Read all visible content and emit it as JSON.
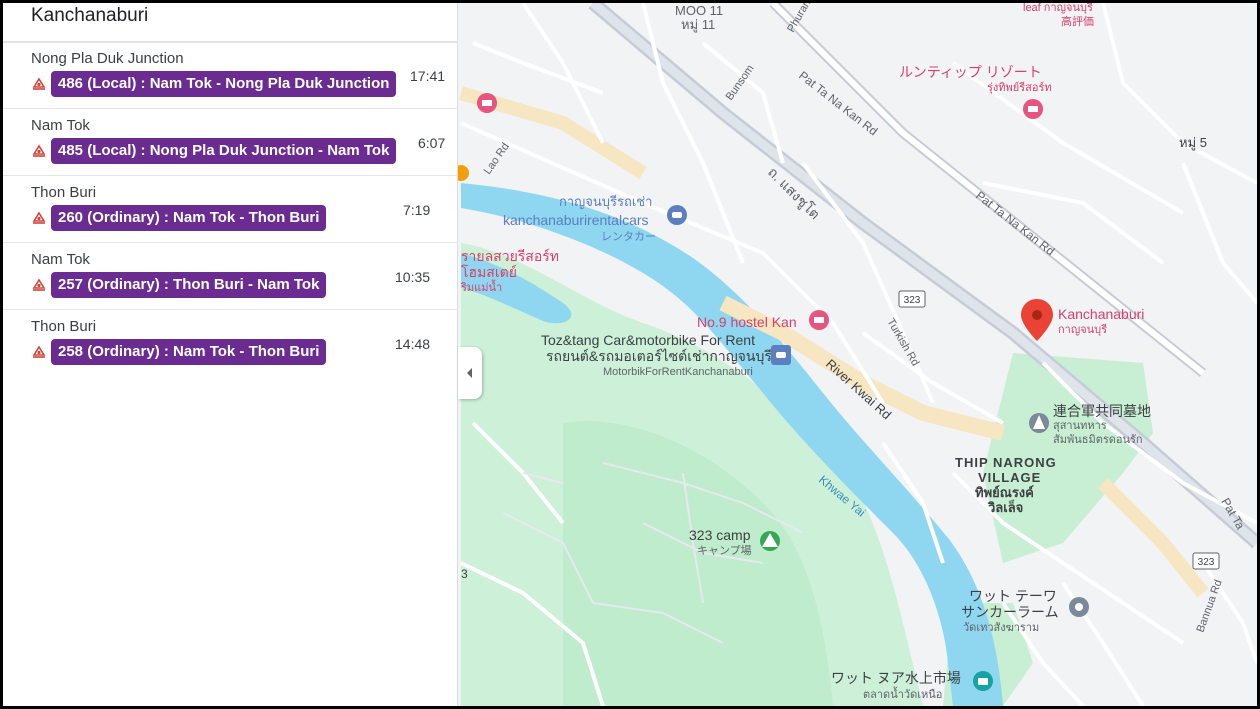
{
  "panel": {
    "title": "Kanchanaburi",
    "departures": [
      {
        "destination": "Nong Pla Duk Junction",
        "route": "486 (Local) : Nam Tok - Nong Pla Duk Junction",
        "time": "17:41"
      },
      {
        "destination": "Nam Tok",
        "route": "485 (Local) : Nong Pla Duk Junction - Nam Tok",
        "time": "6:07"
      },
      {
        "destination": "Thon Buri",
        "route": "260 (Ordinary) : Nam Tok - Thon Buri",
        "time": "7:19"
      },
      {
        "destination": "Nam Tok",
        "route": "257 (Ordinary) : Thon Buri - Nam Tok",
        "time": "10:35"
      },
      {
        "destination": "Thon Buri",
        "route": "258 (Ordinary) : Nam Tok - Thon Buri",
        "time": "14:48"
      }
    ]
  },
  "map": {
    "labels": {
      "moo11": "MOO 11",
      "moo11_th": "หมู่ 11",
      "leaf": "leaf กาญจนบุรี",
      "leaf_jp": "高評価",
      "phuran": "Phuran",
      "bunsom": "Bunsom",
      "pat_ta_na_kan_1": "Pat Ta Na Kan Rd",
      "pat_ta_na_kan_2": "Pat Ta Na Kan Rd",
      "pat_ta": "Pat Ta",
      "lao_rd": "Lao Rd",
      "saeng_chuto": "ถ. แสงชูโต",
      "resort_jp": "ルンティップ リゾート",
      "resort_th": "รุ่งทิพย์รีสอร์ท",
      "moo5": "หมู่ 5",
      "rental_th": "กาญจนบุรีรถเช่า",
      "rental_en": "kanchanaburirentalcars",
      "rental_jp": "レンタカー",
      "resort2_a": "รายลสวยรีสอร์ท",
      "resort2_b": "โฮมสเตย์",
      "resort2_c": "ริมแม่น้ำ",
      "route323": "323",
      "route323_b": "323",
      "kanchanaburi": "Kanchanaburi",
      "kanchanaburi_th": "กาญจนบุรี",
      "no9": "No.9 hostel Kan",
      "turkish": "Turkish Rd",
      "toz_en": "Toz&tang Car&motorbike For Rent",
      "toz_th": "รถยนต์&รถมอเตอร์ไซต์เช่ากาญจนบุรี",
      "toz_sub": "MotorbikForRentKanchanaburi",
      "river_kwai": "River Kwai Rd",
      "cemetery_jp": "連合軍共同墓地",
      "cemetery_th1": "สุสานทหาร",
      "cemetery_th2": "สัมพันธมิตรดอนรัก",
      "thip1": "THIP NARONG",
      "thip2": "VILLAGE",
      "thip_th1": "ทิพย์ณรงค์",
      "thip_th2": "วิลเล็จ",
      "khwae_yai": "Khwae Yai",
      "camp": "323 camp",
      "camp_jp": "キャンプ場",
      "three": "3",
      "temple_jp1": "ワット テーワ",
      "temple_jp2": "サンカーラーム",
      "temple_th": "วัดเทวสังฆาราม",
      "bannua": "Bannua Rd",
      "market_jp": "ワット ヌア水上市場",
      "market_th": "ตลาดน้ำวัดเหนือ"
    }
  }
}
